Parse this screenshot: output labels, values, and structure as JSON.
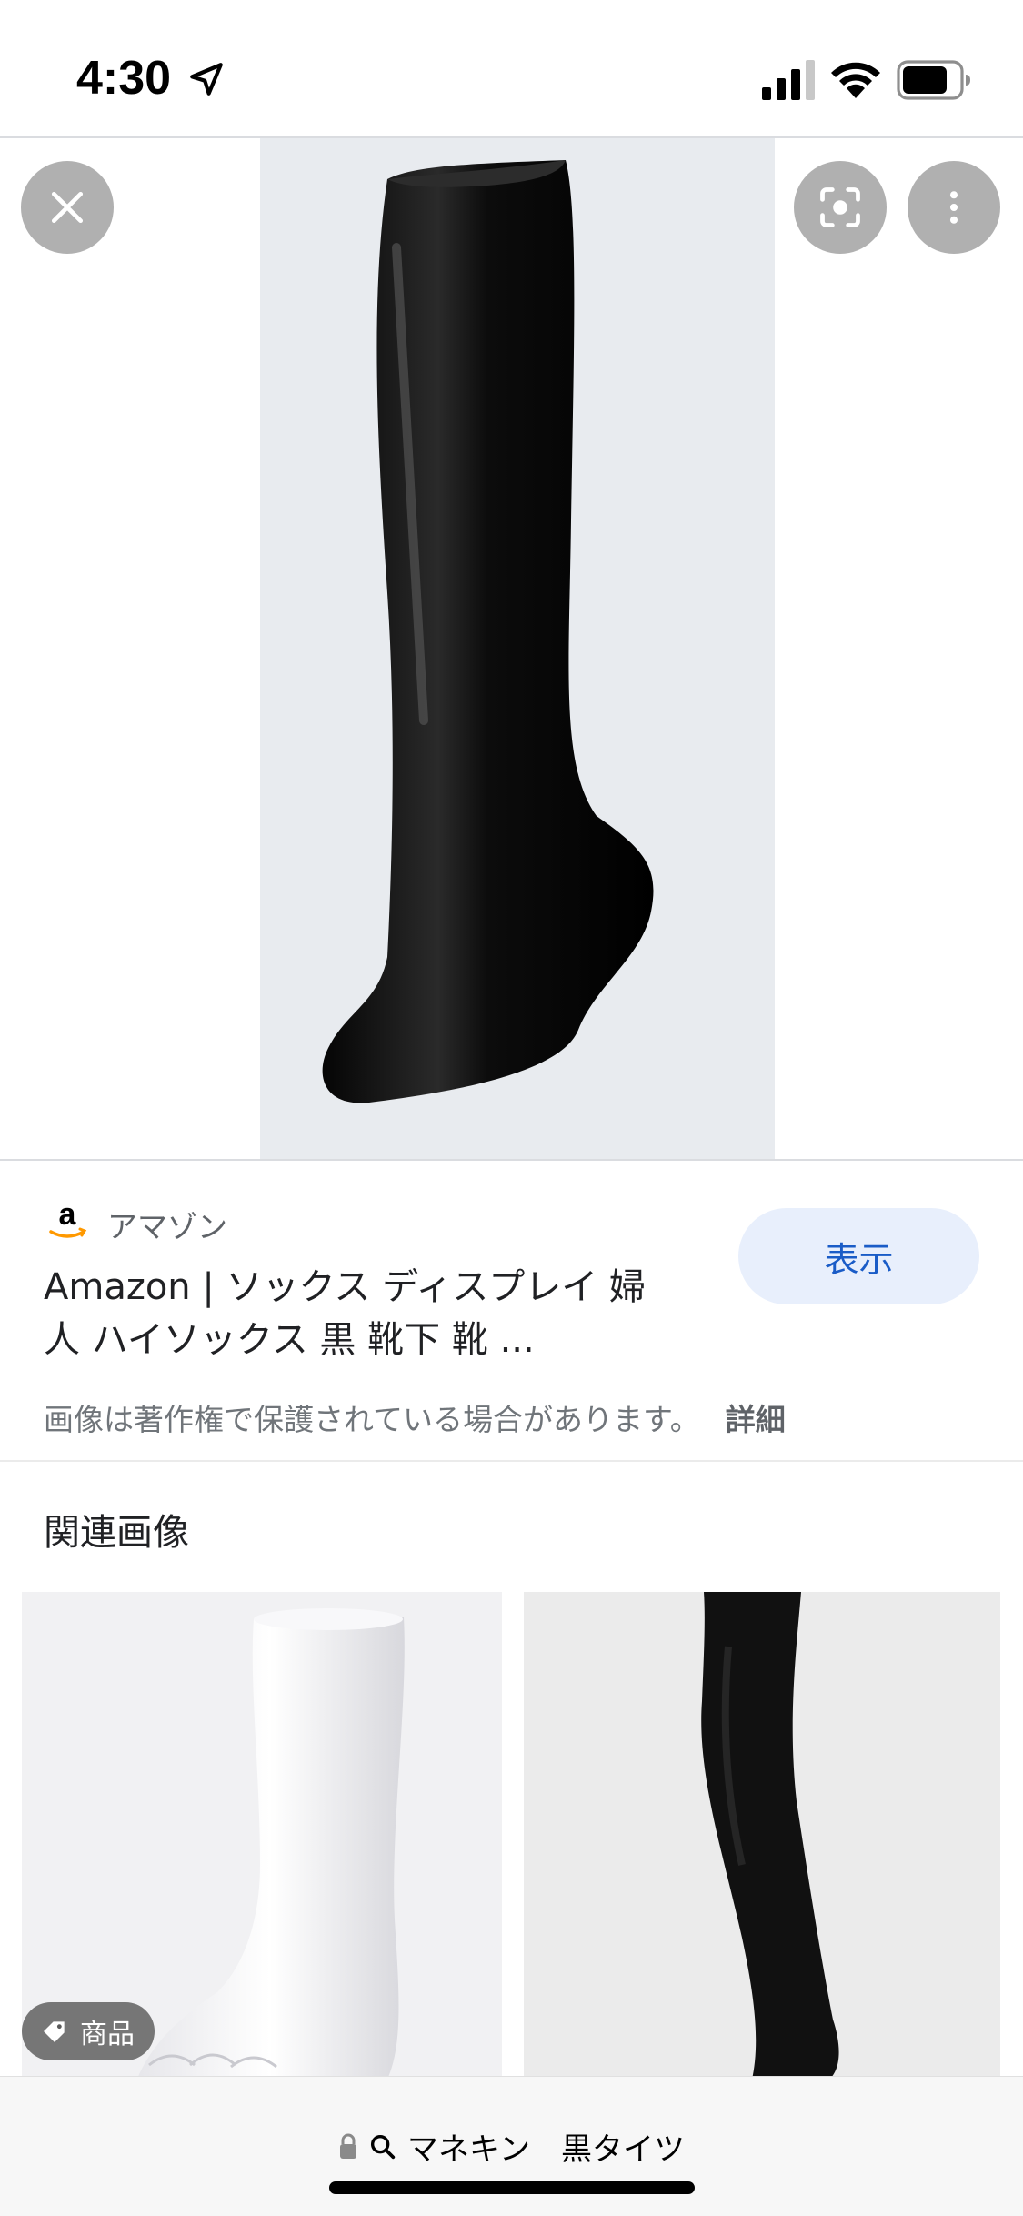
{
  "status_bar": {
    "time": "4:30"
  },
  "viewer": {
    "close_icon": "close-icon",
    "lens_icon": "google-lens-icon",
    "more_icon": "more-vert-icon"
  },
  "source": {
    "site_name": "アマゾン",
    "title": "Amazon | ソックス ディスプレイ 婦人 ハイソックス 黒 靴下 靴 ...",
    "view_button": "表示",
    "copyright_notice": "画像は著作権で保護されている場合があります。",
    "details_link": "詳細"
  },
  "related": {
    "heading": "関連画像",
    "product_tag": "商品"
  },
  "url_bar": {
    "query": "マネキン　黒タイツ"
  },
  "colors": {
    "accent": "#1a5cc7",
    "view_button_bg": "#e8effc"
  }
}
